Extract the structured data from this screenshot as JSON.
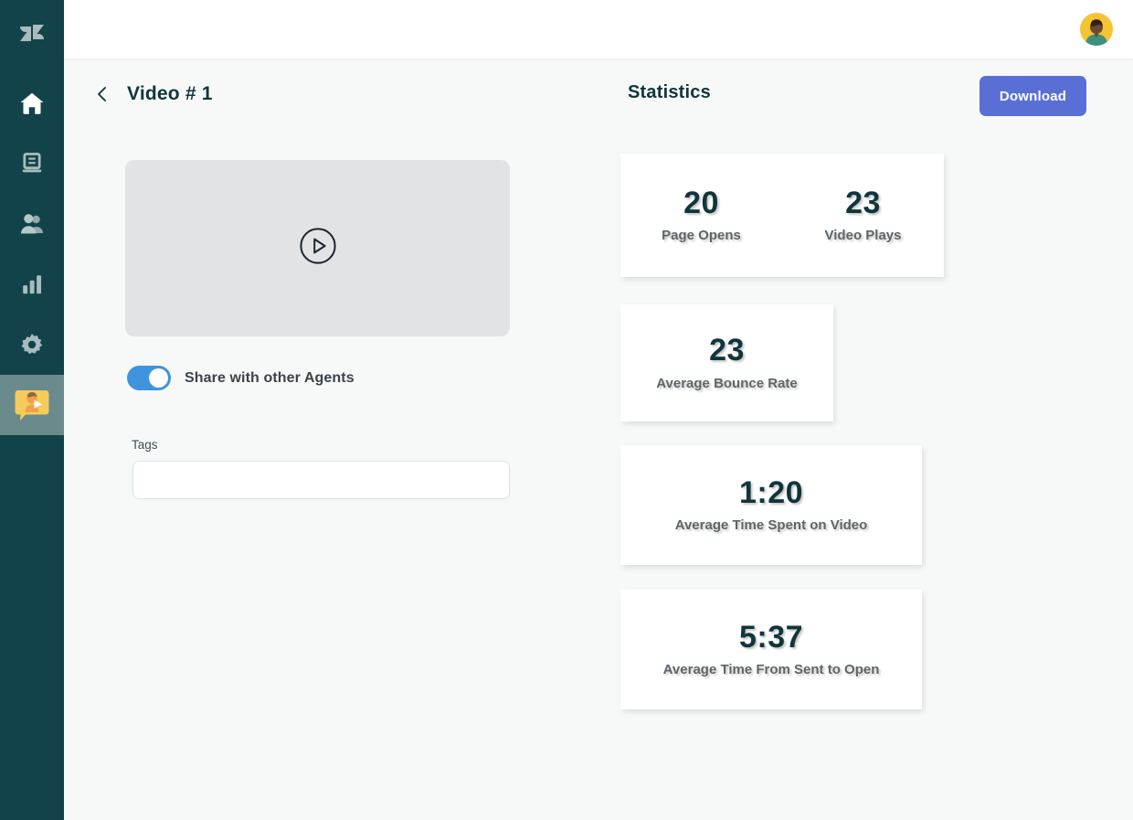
{
  "app": {
    "brand_icon": "zendesk-logo-icon",
    "accent_color": "#5a6fd6",
    "sidebar_bg": "#12434a",
    "page_bg": "#f7f9f9",
    "toggle_on_color": "#3f94dd"
  },
  "sidebar": {
    "items": [
      {
        "name": "home",
        "icon": "home-icon",
        "active": false
      },
      {
        "name": "tickets",
        "icon": "ticket-list-icon",
        "active": false
      },
      {
        "name": "customers",
        "icon": "people-icon",
        "active": false
      },
      {
        "name": "reporting",
        "icon": "bar-chart-icon",
        "active": false
      },
      {
        "name": "settings",
        "icon": "gear-icon",
        "active": false
      },
      {
        "name": "video-messages",
        "icon": "video-message-icon",
        "active": true
      }
    ]
  },
  "topbar": {
    "avatar_icon": "user-avatar"
  },
  "header": {
    "back_icon": "chevron-left-icon",
    "title": "Video # 1",
    "statistics_title": "Statistics",
    "download_label": "Download"
  },
  "video": {
    "play_icon": "play-circle-icon"
  },
  "share": {
    "label": "Share with other Agents",
    "enabled": true
  },
  "tags": {
    "label": "Tags",
    "value": "",
    "placeholder": ""
  },
  "stats": {
    "cards": [
      {
        "id": "card-0",
        "blocks": [
          {
            "value": "20",
            "label": "Page Opens"
          },
          {
            "value": "23",
            "label": "Video Plays"
          }
        ]
      },
      {
        "id": "card-1",
        "blocks": [
          {
            "value": "23",
            "label": "Average Bounce Rate"
          }
        ]
      },
      {
        "id": "card-2",
        "blocks": [
          {
            "value": "1:20",
            "label": "Average Time Spent on Video"
          }
        ]
      },
      {
        "id": "card-3",
        "blocks": [
          {
            "value": "5:37",
            "label": "Average Time From Sent to Open"
          }
        ]
      }
    ]
  }
}
